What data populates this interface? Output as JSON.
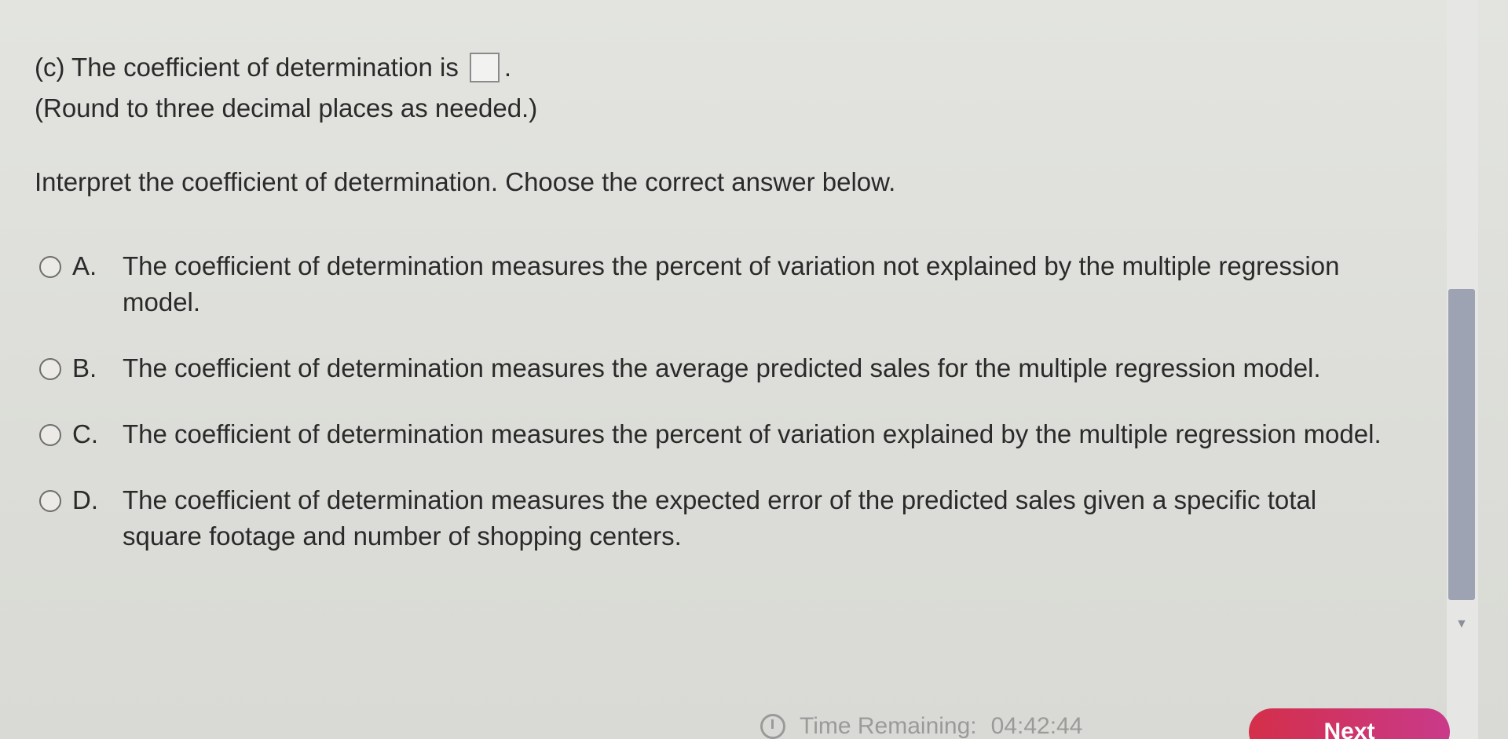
{
  "question": {
    "part_c_prefix": "(c) The coefficient of determination is",
    "part_c_suffix": ".",
    "answer_value": "",
    "rounding_note": "(Round to three decimal places as needed.)",
    "interpret_prompt": "Interpret the coefficient of determination. Choose the correct answer below."
  },
  "options": [
    {
      "letter": "A.",
      "text": "The coefficient of determination measures the percent of variation not explained by the multiple regression model."
    },
    {
      "letter": "B.",
      "text": "The coefficient of determination measures the average predicted sales for the multiple regression model."
    },
    {
      "letter": "C.",
      "text": "The coefficient of determination measures the percent of variation explained by the multiple regression model."
    },
    {
      "letter": "D.",
      "text": "The coefficient of determination measures the expected error of the predicted sales given a specific total square footage and number of shopping centers."
    }
  ],
  "footer": {
    "timer_label": "Time Remaining:",
    "timer_value": "04:42:44",
    "next_label": "Next"
  },
  "colors": {
    "background": "#dfe0dc",
    "scroll_thumb": "#9ea3b4",
    "next_button": "#d42f4a"
  }
}
